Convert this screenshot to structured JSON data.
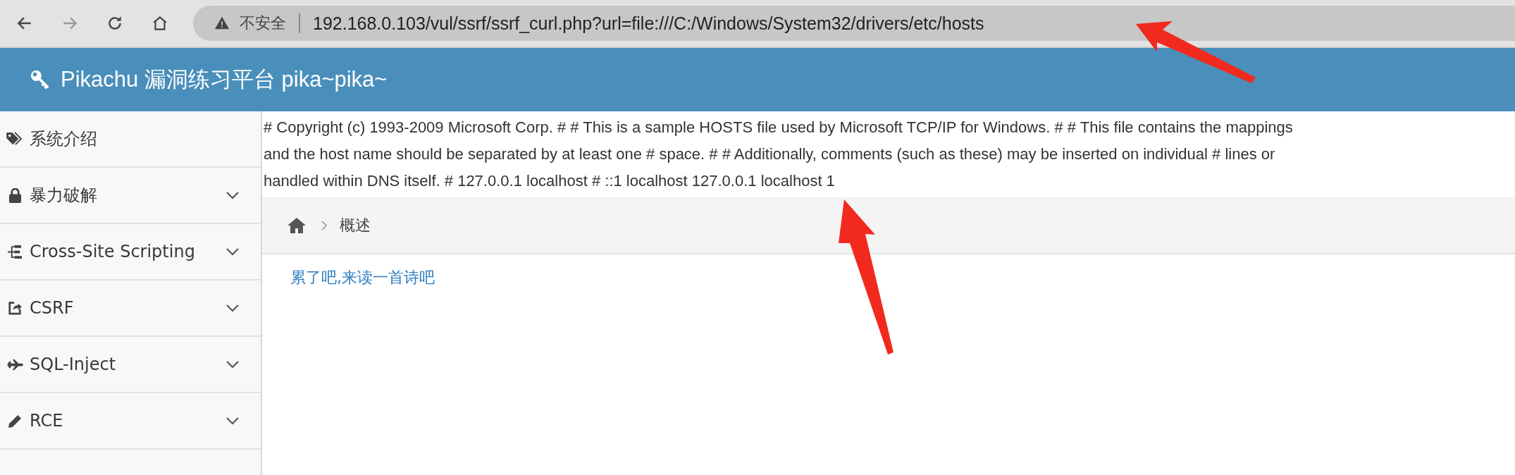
{
  "browser": {
    "forward_disabled": true,
    "security_label": "不安全",
    "url": "192.168.0.103/vul/ssrf/ssrf_curl.php?url=file:///C:/Windows/System32/drivers/etc/hosts"
  },
  "header": {
    "title": "Pikachu 漏洞练习平台 pika~pika~"
  },
  "sidebar": {
    "items": [
      {
        "label": "系统介绍",
        "expandable": false
      },
      {
        "label": "暴力破解",
        "expandable": true
      },
      {
        "label": "Cross-Site Scripting",
        "expandable": true
      },
      {
        "label": "CSRF",
        "expandable": true
      },
      {
        "label": "SQL-Inject",
        "expandable": true
      },
      {
        "label": "RCE",
        "expandable": true
      }
    ]
  },
  "output": {
    "lines": [
      "# Copyright (c) 1993-2009 Microsoft Corp. # # This is a sample HOSTS file used by Microsoft TCP/IP for Windows. # # This file contains the mappings",
      "and the host name should be separated by at least one # space. # # Additionally, comments (such as these) may be inserted on individual # lines or",
      "handled within DNS itself. # 127.0.0.1 localhost # ::1 localhost 127.0.0.1 localhost 1"
    ]
  },
  "breadcrumb": {
    "current": "概述"
  },
  "content": {
    "link": "累了吧,来读一首诗吧"
  }
}
